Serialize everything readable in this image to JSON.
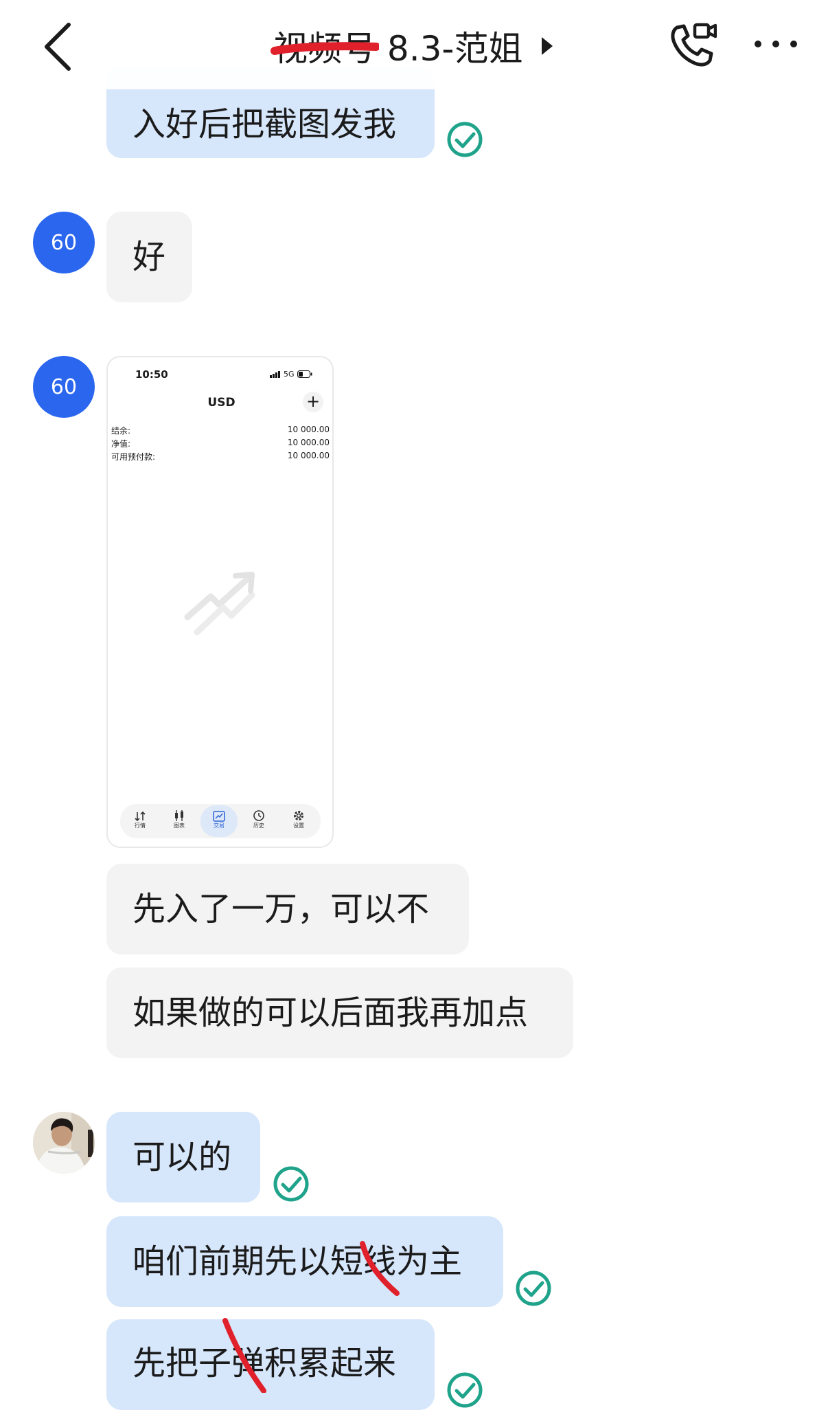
{
  "header": {
    "title": "视频号 8.3-范姐"
  },
  "messages": [
    {
      "text": "入好后把截图发我"
    },
    {
      "avatar": "60",
      "text": "好"
    },
    {
      "avatar": "60"
    },
    {
      "text": "先入了一万，可以不"
    },
    {
      "text": "如果做的可以后面我再加点"
    },
    {
      "text": "可以的"
    },
    {
      "text": "咱们前期先以短线为主"
    },
    {
      "text": "先把子弹积累起来"
    }
  ],
  "screenshot": {
    "time": "10:50",
    "network": "5G",
    "title": "USD",
    "rows": [
      {
        "label": "结余:",
        "value": "10 000.00"
      },
      {
        "label": "净值:",
        "value": "10 000.00"
      },
      {
        "label": "可用预付款:",
        "value": "10 000.00"
      }
    ],
    "nav": [
      {
        "label": "行情",
        "icon": "updown-arrows-icon"
      },
      {
        "label": "图表",
        "icon": "candles-icon"
      },
      {
        "label": "交易",
        "icon": "trend-chart-icon",
        "active": true
      },
      {
        "label": "历史",
        "icon": "clock-icon"
      },
      {
        "label": "设置",
        "icon": "gear-icon"
      }
    ]
  },
  "colors": {
    "outgoing_bubble": "#d6e6fb",
    "incoming_bubble": "#f3f3f3",
    "read_check": "#1fa38a",
    "avatar_blue": "#2b66ee",
    "scribble_red": "#e0202a"
  }
}
